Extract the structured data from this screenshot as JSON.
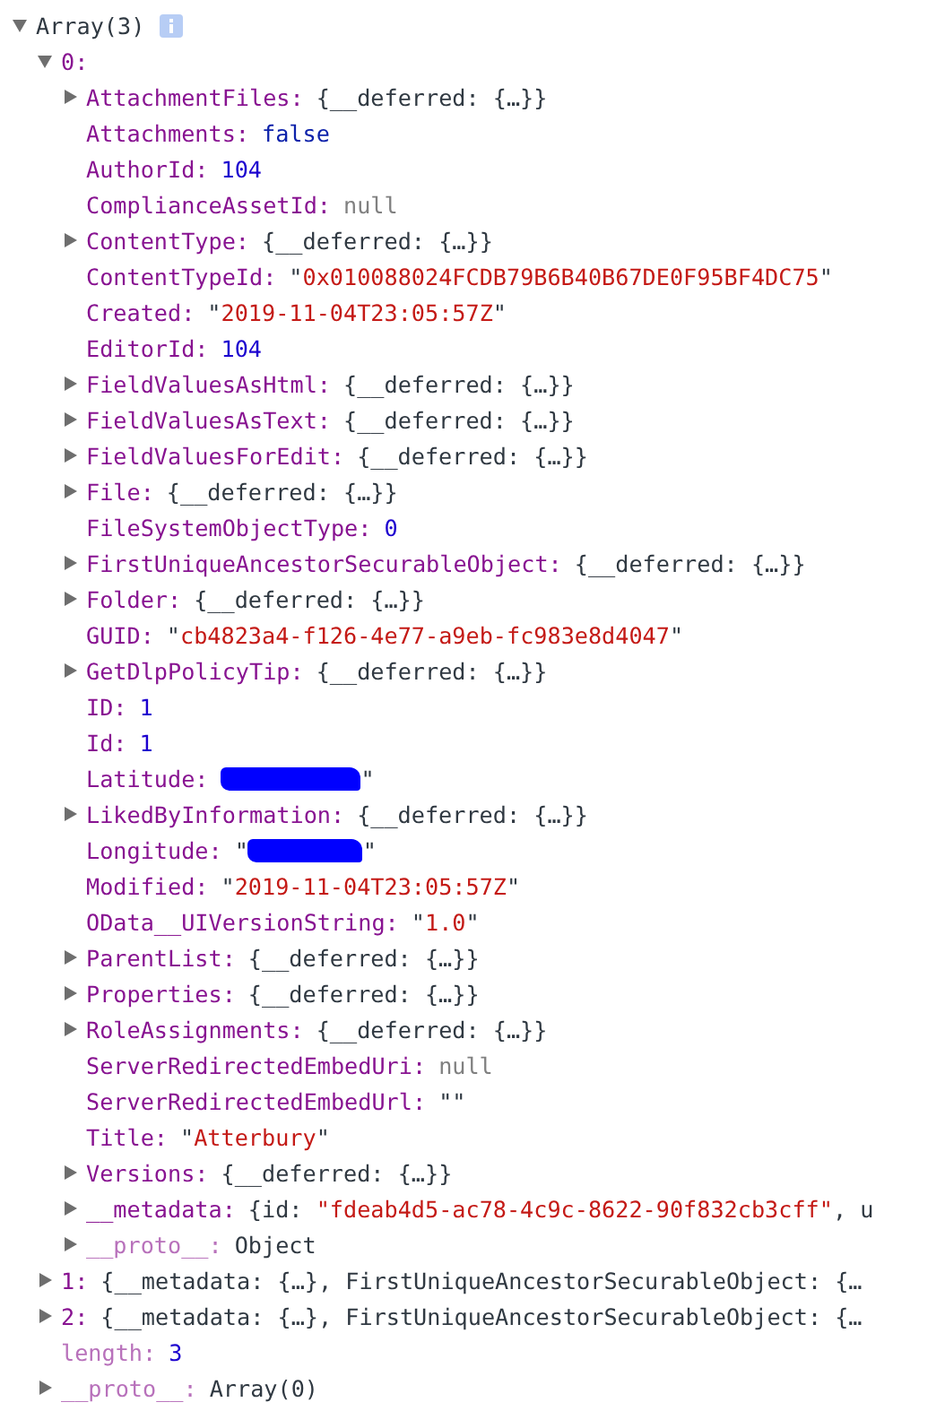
{
  "root": {
    "label": "Array(3)",
    "expanded": true,
    "children": [
      {
        "key": "0:",
        "dim": false,
        "expanded": true,
        "children": [
          {
            "key": "AttachmentFiles:",
            "dim": false,
            "expanded": false,
            "value": [
              {
                "text": "{__deferred: {…}}",
                "kind": "plain"
              }
            ]
          },
          {
            "key": "Attachments:",
            "dim": false,
            "value": [
              {
                "text": "false",
                "kind": "boolean"
              }
            ]
          },
          {
            "key": "AuthorId:",
            "dim": false,
            "value": [
              {
                "text": "104",
                "kind": "number"
              }
            ]
          },
          {
            "key": "ComplianceAssetId:",
            "dim": false,
            "value": [
              {
                "text": "null",
                "kind": "null"
              }
            ]
          },
          {
            "key": "ContentType:",
            "dim": false,
            "expanded": false,
            "value": [
              {
                "text": "{__deferred: {…}}",
                "kind": "plain"
              }
            ]
          },
          {
            "key": "ContentTypeId:",
            "dim": false,
            "value": [
              {
                "text": "\"",
                "kind": "plain"
              },
              {
                "text": "0x010088024FCDB79B6B40B67DE0F95BF4DC75",
                "kind": "string"
              },
              {
                "text": "\"",
                "kind": "plain"
              }
            ]
          },
          {
            "key": "Created:",
            "dim": false,
            "value": [
              {
                "text": "\"",
                "kind": "plain"
              },
              {
                "text": "2019-11-04T23:05:57Z",
                "kind": "string"
              },
              {
                "text": "\"",
                "kind": "plain"
              }
            ]
          },
          {
            "key": "EditorId:",
            "dim": false,
            "value": [
              {
                "text": "104",
                "kind": "number"
              }
            ]
          },
          {
            "key": "FieldValuesAsHtml:",
            "dim": false,
            "expanded": false,
            "value": [
              {
                "text": "{__deferred: {…}}",
                "kind": "plain"
              }
            ]
          },
          {
            "key": "FieldValuesAsText:",
            "dim": false,
            "expanded": false,
            "value": [
              {
                "text": "{__deferred: {…}}",
                "kind": "plain"
              }
            ]
          },
          {
            "key": "FieldValuesForEdit:",
            "dim": false,
            "expanded": false,
            "value": [
              {
                "text": "{__deferred: {…}}",
                "kind": "plain"
              }
            ]
          },
          {
            "key": "File:",
            "dim": false,
            "expanded": false,
            "value": [
              {
                "text": "{__deferred: {…}}",
                "kind": "plain"
              }
            ]
          },
          {
            "key": "FileSystemObjectType:",
            "dim": false,
            "value": [
              {
                "text": "0",
                "kind": "number"
              }
            ]
          },
          {
            "key": "FirstUniqueAncestorSecurableObject:",
            "dim": false,
            "expanded": false,
            "value": [
              {
                "text": "{__deferred: {…}}",
                "kind": "plain"
              }
            ]
          },
          {
            "key": "Folder:",
            "dim": false,
            "expanded": false,
            "value": [
              {
                "text": "{__deferred: {…}}",
                "kind": "plain"
              }
            ]
          },
          {
            "key": "GUID:",
            "dim": false,
            "value": [
              {
                "text": "\"",
                "kind": "plain"
              },
              {
                "text": "cb4823a4-f126-4e77-a9eb-fc983e8d4047",
                "kind": "string"
              },
              {
                "text": "\"",
                "kind": "plain"
              }
            ]
          },
          {
            "key": "GetDlpPolicyTip:",
            "dim": false,
            "expanded": false,
            "value": [
              {
                "text": "{__deferred: {…}}",
                "kind": "plain"
              }
            ]
          },
          {
            "key": "ID:",
            "dim": false,
            "value": [
              {
                "text": "1",
                "kind": "number"
              }
            ]
          },
          {
            "key": "Id:",
            "dim": false,
            "value": [
              {
                "text": "1",
                "kind": "number"
              }
            ]
          },
          {
            "key": "Latitude:",
            "dim": false,
            "value": [
              {
                "kind": "redacted"
              },
              {
                "text": "\"",
                "kind": "plain"
              }
            ]
          },
          {
            "key": "LikedByInformation:",
            "dim": false,
            "expanded": false,
            "value": [
              {
                "text": "{__deferred: {…}}",
                "kind": "plain"
              }
            ]
          },
          {
            "key": "Longitude:",
            "dim": false,
            "value": [
              {
                "text": "\"",
                "kind": "plain"
              },
              {
                "kind": "redacted"
              },
              {
                "text": "\"",
                "kind": "plain"
              }
            ]
          },
          {
            "key": "Modified:",
            "dim": false,
            "value": [
              {
                "text": "\"",
                "kind": "plain"
              },
              {
                "text": "2019-11-04T23:05:57Z",
                "kind": "string"
              },
              {
                "text": "\"",
                "kind": "plain"
              }
            ]
          },
          {
            "key": "OData__UIVersionString:",
            "dim": false,
            "value": [
              {
                "text": "\"",
                "kind": "plain"
              },
              {
                "text": "1.0",
                "kind": "string"
              },
              {
                "text": "\"",
                "kind": "plain"
              }
            ]
          },
          {
            "key": "ParentList:",
            "dim": false,
            "expanded": false,
            "value": [
              {
                "text": "{__deferred: {…}}",
                "kind": "plain"
              }
            ]
          },
          {
            "key": "Properties:",
            "dim": false,
            "expanded": false,
            "value": [
              {
                "text": "{__deferred: {…}}",
                "kind": "plain"
              }
            ]
          },
          {
            "key": "RoleAssignments:",
            "dim": false,
            "expanded": false,
            "value": [
              {
                "text": "{__deferred: {…}}",
                "kind": "plain"
              }
            ]
          },
          {
            "key": "ServerRedirectedEmbedUri:",
            "dim": false,
            "value": [
              {
                "text": "null",
                "kind": "null"
              }
            ]
          },
          {
            "key": "ServerRedirectedEmbedUrl:",
            "dim": false,
            "value": [
              {
                "text": "\"\"",
                "kind": "plain"
              }
            ]
          },
          {
            "key": "Title:",
            "dim": false,
            "value": [
              {
                "text": "\"",
                "kind": "plain"
              },
              {
                "text": "Atterbury",
                "kind": "string"
              },
              {
                "text": "\"",
                "kind": "plain"
              }
            ]
          },
          {
            "key": "Versions:",
            "dim": false,
            "expanded": false,
            "value": [
              {
                "text": "{__deferred: {…}}",
                "kind": "plain"
              }
            ]
          },
          {
            "key": "__metadata:",
            "dim": false,
            "expanded": false,
            "value": [
              {
                "text": "{id: ",
                "kind": "plain"
              },
              {
                "text": "\"fdeab4d5-ac78-4c9c-8622-90f832cb3cff\"",
                "kind": "string"
              },
              {
                "text": ", u",
                "kind": "plain"
              }
            ]
          },
          {
            "key": "__proto__:",
            "dim": true,
            "expanded": false,
            "value": [
              {
                "text": "Object",
                "kind": "plain"
              }
            ]
          }
        ]
      },
      {
        "key": "1:",
        "dim": false,
        "expanded": false,
        "value": [
          {
            "text": "{__metadata: {…}, FirstUniqueAncestorSecurableObject: {…",
            "kind": "plain"
          }
        ]
      },
      {
        "key": "2:",
        "dim": false,
        "expanded": false,
        "value": [
          {
            "text": "{__metadata: {…}, FirstUniqueAncestorSecurableObject: {…",
            "kind": "plain"
          }
        ]
      },
      {
        "key": "length:",
        "dim": true,
        "value": [
          {
            "text": "3",
            "kind": "number"
          }
        ]
      },
      {
        "key": "__proto__:",
        "dim": true,
        "expanded": false,
        "value": [
          {
            "text": "Array(0)",
            "kind": "plain"
          }
        ]
      }
    ]
  }
}
